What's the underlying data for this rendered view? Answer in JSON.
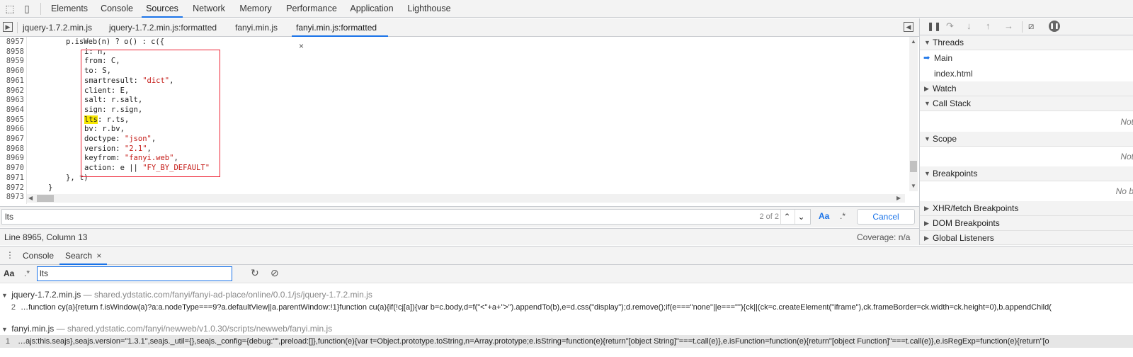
{
  "top_tabs": [
    "Elements",
    "Console",
    "Sources",
    "Network",
    "Memory",
    "Performance",
    "Application",
    "Lighthouse"
  ],
  "active_top_tab": "Sources",
  "file_tabs": [
    "jquery-1.7.2.min.js",
    "jquery-1.7.2.min.js:formatted",
    "fanyi.min.js",
    "fanyi.min.js:formatted"
  ],
  "file_tab_close": "×",
  "code": {
    "line_numbers": [
      "8957",
      "8958",
      "8959",
      "8960",
      "8961",
      "8962",
      "8963",
      "8964",
      "8965",
      "8966",
      "8967",
      "8968",
      "8969",
      "8970",
      "8971",
      "8972",
      "8973"
    ],
    "l0": "p.isWeb(n) ? o() : c({",
    "l1": "i: n,",
    "l2": "from: C,",
    "l3": "to: S,",
    "l4a": "smartresult: ",
    "l4b": "\"dict\"",
    "l4c": ",",
    "l5": "client: E,",
    "l6": "salt: r.salt,",
    "l7": "sign: r.sign,",
    "l8a": "lts",
    "l8b": ": r.ts,",
    "l9": "bv: r.bv,",
    "l10a": "doctype: ",
    "l10b": "\"json\"",
    "l10c": ",",
    "l11a": "version: ",
    "l11b": "\"2.1\"",
    "l11c": ",",
    "l12a": "keyfrom: ",
    "l12b": "\"fanyi.web\"",
    "l12c": ",",
    "l13a": "action: e || ",
    "l13b": "\"FY_BY_DEFAULT\"",
    "l14": "}, t)",
    "l15": "}",
    "l16": ""
  },
  "search": {
    "value": "lts",
    "count": "2 of 2",
    "case_label": "Aa",
    "regex_label": ".*",
    "cancel_label": "Cancel"
  },
  "status": {
    "position": "Line 8965, Column 13",
    "coverage": "Coverage: n/a"
  },
  "right_panel": {
    "threads_label": "Threads",
    "thread_main": "Main",
    "thread_index": "index.html",
    "watch_label": "Watch",
    "callstack_label": "Call Stack",
    "callstack_empty": "Not",
    "scope_label": "Scope",
    "scope_empty": "Not",
    "breakpoints_label": "Breakpoints",
    "breakpoints_empty": "No b",
    "xhr_label": "XHR/fetch Breakpoints",
    "dom_label": "DOM Breakpoints",
    "global_label": "Global Listeners"
  },
  "drawer": {
    "tabs": [
      "Console",
      "Search"
    ],
    "active_tab": "Search",
    "close": "×",
    "search_value": "lts",
    "case_label": "Aa",
    "regex_label": ".*",
    "results": [
      {
        "file": "jquery-1.7.2.min.js",
        "url": "— shared.ydstatic.com/fanyi/fanyi-ad-place/online/0.0.1/js/jquery-1.7.2.min.js",
        "line_no": "2",
        "text": "…function cy(a){return f.isWindow(a)?a:a.nodeType===9?a.defaultView||a.parentWindow:!1}function cu(a){if(!cj[a]){var b=c.body,d=f(\"<\"+a+\">\").appendTo(b),e=d.css(\"display\");d.remove();if(e===\"none\"||e===\"\"){ck||(ck=c.createElement(\"iframe\"),ck.frameBorder=ck.width=ck.height=0),b.appendChild("
      },
      {
        "file": "fanyi.min.js",
        "url": "— shared.ydstatic.com/fanyi/newweb/v1.0.30/scripts/newweb/fanyi.min.js",
        "line_no": "1",
        "text": "…ajs:this.seajs},seajs.version=\"1.3.1\",seajs._util={},seajs._config={debug:\"\",preload:[]},function(e){var t=Object.prototype.toString,n=Array.prototype;e.isString=function(e){return\"[object String]\"===t.call(e)},e.isFunction=function(e){return\"[object Function]\"===t.call(e)},e.isRegExp=function(e){return\"[o"
      }
    ]
  }
}
